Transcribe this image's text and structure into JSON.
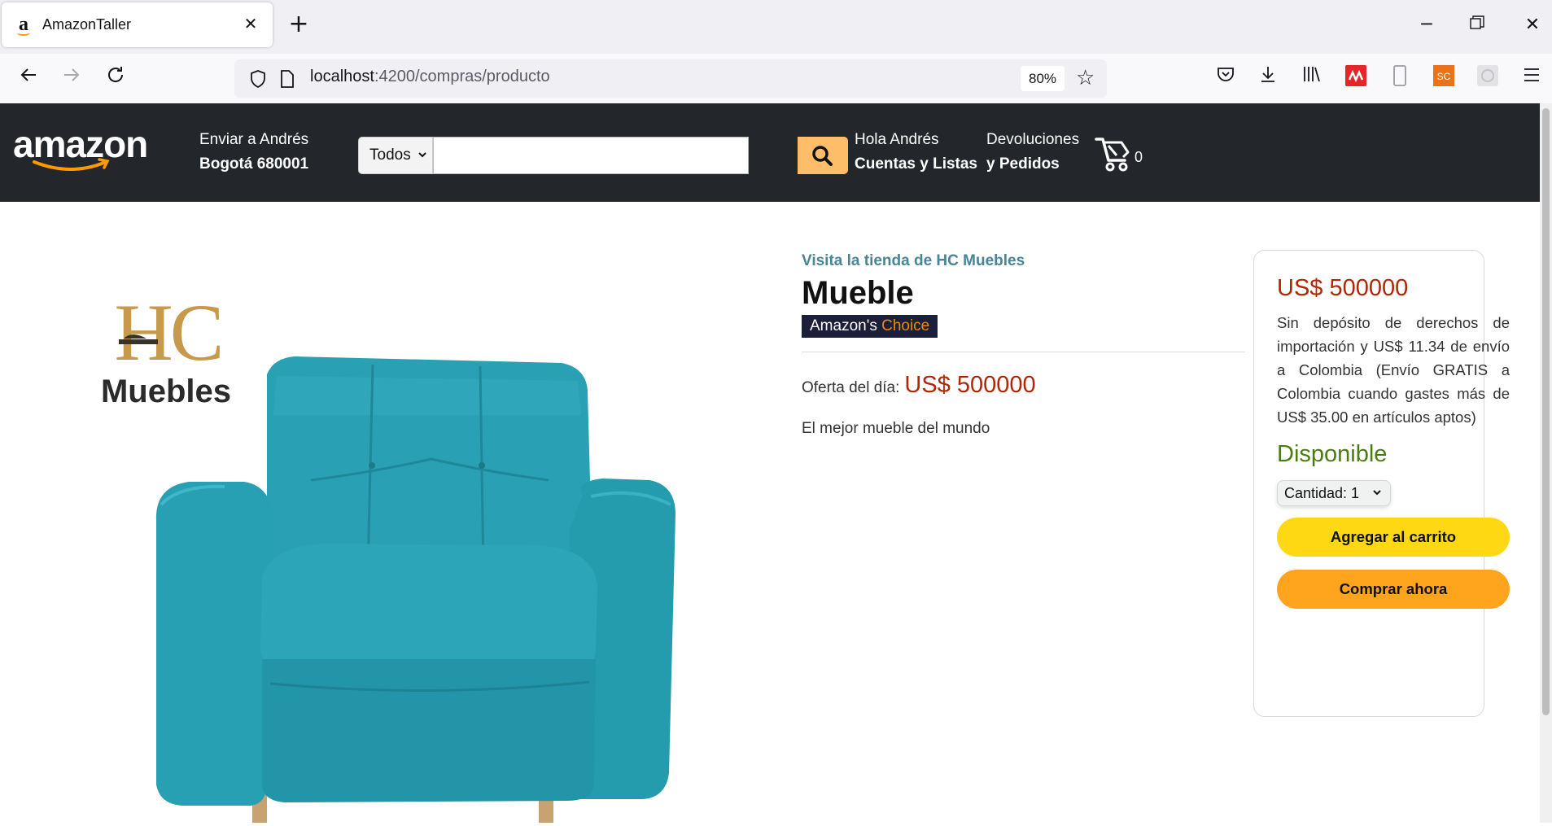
{
  "browser": {
    "tab_title": "AmazonTaller",
    "url_host": "localhost",
    "url_rest": ":4200/compras/producto",
    "zoom": "80%"
  },
  "header": {
    "deliver_line1": "Enviar a Andrés",
    "deliver_line2": "Bogotá 680001",
    "search_category": "Todos",
    "search_value": "",
    "account_line1": "Hola Andrés",
    "account_line2": "Cuentas y Listas",
    "returns_line1": "Devoluciones",
    "returns_line2": "y Pedidos",
    "cart_count": "0"
  },
  "product": {
    "store_link": "Visita la tienda de HC Muebles",
    "title": "Mueble",
    "choice_prefix": "Amazon's",
    "choice_suffix": "Choice",
    "offer_label": "Oferta del día:",
    "offer_price": "US$ 500000",
    "description": "El mejor mueble del mundo",
    "brand_logo_line1": "HC",
    "brand_logo_line2": "Muebles"
  },
  "buybox": {
    "price": "US$ 500000",
    "shipping_text": "Sin depósito de derechos de importación y US$ 11.34 de envío a Colombia (Envío GRATIS a Colombia cuando gastes más de US$ 35.00 en artículos aptos)",
    "availability": "Disponible",
    "quantity_label": "Cantidad: 1",
    "add_to_cart": "Agregar al carrito",
    "buy_now": "Comprar ahora"
  },
  "colors": {
    "header_bg": "#23272b",
    "search_button": "#febd69",
    "price": "#b12704",
    "available": "#4a7d11",
    "add_to_cart_bg": "#ffd814",
    "buy_now_bg": "#ffa41c",
    "sofa": "#2fa3b5"
  }
}
